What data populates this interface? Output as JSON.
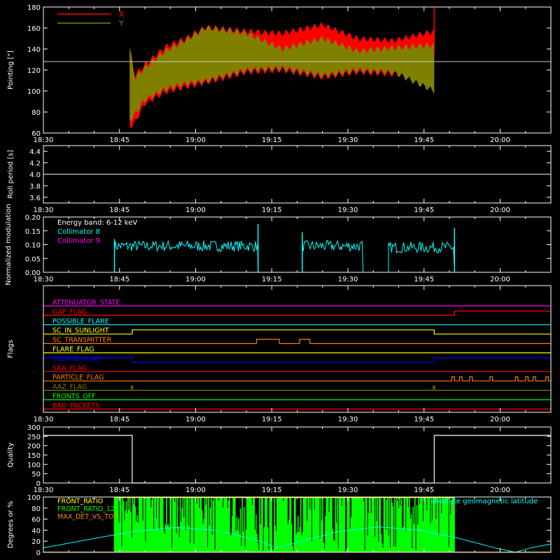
{
  "colors": {
    "background": "#000000",
    "axes": "#ffffff",
    "x_red": "#ff0000",
    "y_olive": "#808000",
    "cyan": "#00ffff",
    "magenta": "#ff00ff",
    "green": "#00ff00",
    "orange": "#ff8000",
    "yellow": "#ffff00",
    "blue": "#0000ff"
  },
  "time_ticks": [
    "18:30",
    "18:45",
    "19:00",
    "19:15",
    "19:30",
    "19:45",
    "20:00"
  ],
  "time_range_minutes": [
    0,
    100
  ],
  "chart_data": [
    {
      "type": "area",
      "name": "pointing",
      "ylabel": "Pointing [\"]",
      "ylim": [
        60,
        180
      ],
      "yticks": [
        "60",
        "80",
        "100",
        "120",
        "140",
        "160",
        "180"
      ],
      "legend": [
        {
          "label": "X",
          "color": "#ff0000"
        },
        {
          "label": "Y",
          "color": "#808000"
        }
      ],
      "legend_position": "top-left",
      "reference_line": 128,
      "data_start_minute": 17,
      "data_end_minute": 77,
      "series": [
        {
          "name": "X",
          "x": [
            17,
            18,
            20,
            24,
            28,
            32,
            40,
            47,
            55,
            62,
            69,
            77
          ],
          "ymin": [
            66,
            70,
            88,
            99,
            104,
            108,
            118,
            120,
            113,
            118,
            116,
            117
          ],
          "ymax": [
            140,
            115,
            125,
            142,
            150,
            161,
            157,
            155,
            163,
            150,
            148,
            157
          ]
        },
        {
          "name": "Y",
          "x": [
            17,
            18,
            20,
            24,
            28,
            32,
            40,
            47,
            55,
            62,
            69,
            77
          ],
          "ymin": [
            72,
            78,
            92,
            102,
            107,
            110,
            120,
            122,
            115,
            120,
            118,
            100
          ],
          "ymax": [
            142,
            112,
            122,
            138,
            148,
            160,
            155,
            140,
            150,
            138,
            141,
            144
          ]
        }
      ],
      "spike_minute": 77,
      "spike_top": 180
    },
    {
      "type": "line",
      "name": "roll",
      "ylabel": "Roll period [s]",
      "ylim": [
        3.5,
        4.5
      ],
      "yticks": [
        "3.6",
        "3.8",
        "4.0",
        "4.2",
        "4.4"
      ],
      "x": [
        0,
        100
      ],
      "y": [
        4.0,
        4.0
      ]
    },
    {
      "type": "line",
      "name": "modulation",
      "ylabel": "Normalized modulation",
      "ylim": [
        0,
        0.2
      ],
      "yticks": [
        "0.00",
        "0.05",
        "0.10",
        "0.15",
        "0.20"
      ],
      "annotation": "Energy band: 6-12 keV",
      "legend": [
        {
          "label": "Collimator 8",
          "color": "#00ffff"
        },
        {
          "label": "Collimator 9",
          "color": "#ff00ff"
        }
      ],
      "legend_position": "top-left",
      "segments": [
        {
          "start": 14,
          "end": 42.3,
          "mean": 0.095,
          "spread": 0.02
        },
        {
          "start": 51,
          "end": 63,
          "mean": 0.095,
          "spread": 0.02
        },
        {
          "start": 68,
          "end": 81,
          "mean": 0.09,
          "spread": 0.02
        }
      ],
      "spikes": [
        {
          "x": 14,
          "y": 0.12
        },
        {
          "x": 42.3,
          "y": 0.175
        },
        {
          "x": 51,
          "y": 0.145
        },
        {
          "x": 81,
          "y": 0.16
        }
      ]
    },
    {
      "type": "line",
      "name": "flags",
      "ylabel": "Flags",
      "flags": [
        {
          "label": "ATTENUATOR_STATE",
          "color": "#ff00ff",
          "steps": [
            [
              0,
              0
            ]
          ]
        },
        {
          "label": "GAP_FLAG",
          "color": "#ff0000",
          "steps": [
            [
              0,
              0
            ],
            [
              81,
              1
            ]
          ]
        },
        {
          "label": "POSSIBLE_FLARE",
          "color": "#00ffff",
          "steps": [
            [
              0,
              0
            ]
          ]
        },
        {
          "label": "SC_IN_SUNLIGHT",
          "color": "#ffff00",
          "steps": [
            [
              0,
              0
            ],
            [
              17.5,
              1
            ],
            [
              77,
              0
            ]
          ]
        },
        {
          "label": "SC_TRANSMITTER",
          "color": "#ff8000",
          "steps": [
            [
              0,
              0
            ],
            [
              42,
              1
            ],
            [
              46.5,
              0
            ],
            [
              50.5,
              1
            ],
            [
              52.5,
              0
            ]
          ]
        },
        {
          "label": "FLARE_FLAG",
          "color": "#ffff00",
          "steps": [
            [
              0,
              0
            ]
          ]
        },
        {
          "label": "ECLIPSE_FLAG",
          "color": "#0000ff",
          "steps": [
            [
              0,
              1
            ],
            [
              17.5,
              0
            ],
            [
              77,
              1
            ]
          ]
        },
        {
          "label": "SAA_FLAG",
          "color": "#ff0000",
          "steps": [
            [
              0,
              0
            ]
          ]
        },
        {
          "label": "PARTICLE_FLAG",
          "color": "#ff8000",
          "steps": [
            [
              0,
              0
            ],
            [
              80.5,
              1
            ],
            [
              81,
              0
            ],
            [
              82,
              1
            ],
            [
              82.5,
              0
            ],
            [
              84,
              1
            ],
            [
              84.5,
              0
            ],
            [
              88,
              1
            ],
            [
              88.5,
              0
            ],
            [
              93,
              1
            ],
            [
              93.5,
              0
            ],
            [
              95,
              1
            ],
            [
              95.5,
              0
            ],
            [
              96.5,
              1
            ],
            [
              97,
              0
            ],
            [
              99,
              1
            ],
            [
              99.5,
              0
            ]
          ]
        },
        {
          "label": "AAZ_FLAG",
          "color": "#808000",
          "steps": [
            [
              0,
              0
            ],
            [
              17.3,
              1
            ],
            [
              17.6,
              0
            ],
            [
              76.8,
              1
            ],
            [
              77.1,
              0
            ]
          ]
        },
        {
          "label": "FRONTS_OFF",
          "color": "#00ff00",
          "steps": [
            [
              0,
              0
            ]
          ]
        },
        {
          "label": "BAD_PACKETS",
          "color": "#ff0000",
          "steps": [
            [
              0,
              0
            ]
          ]
        }
      ]
    },
    {
      "type": "line",
      "name": "quality",
      "ylabel": "Quality",
      "ylim": [
        0,
        300
      ],
      "yticks": [
        "0",
        "50",
        "100",
        "150",
        "200",
        "250",
        "300"
      ],
      "steps": [
        [
          0,
          255
        ],
        [
          17.5,
          0
        ],
        [
          77,
          255
        ],
        [
          100,
          255
        ]
      ]
    },
    {
      "type": "line",
      "name": "ratios",
      "ylabel": "Degrees or %",
      "ylim": [
        0,
        100
      ],
      "yticks": [
        "0",
        "20",
        "40",
        "60",
        "80",
        "100"
      ],
      "legend": [
        {
          "label": "FRONT_RATIO",
          "color": "#ffff00"
        },
        {
          "label": "FRONT_RATIO_1225",
          "color": "#00ff00"
        },
        {
          "label": "MAX_DET_VS_TOT",
          "color": "#ff8000"
        }
      ],
      "legend_position": "top-left",
      "right_label": "absolute geomagnetic latitude",
      "right_label_color": "#00ffff",
      "green_band": [
        14,
        81
      ],
      "latitude": {
        "x": [
          0,
          10,
          18,
          26,
          34,
          42,
          46,
          50,
          58,
          66,
          74,
          82,
          89,
          93,
          96,
          100
        ],
        "y": [
          8,
          25,
          38,
          45,
          40,
          22,
          8,
          18,
          37,
          46,
          40,
          25,
          8,
          0,
          8,
          15
        ]
      }
    }
  ]
}
